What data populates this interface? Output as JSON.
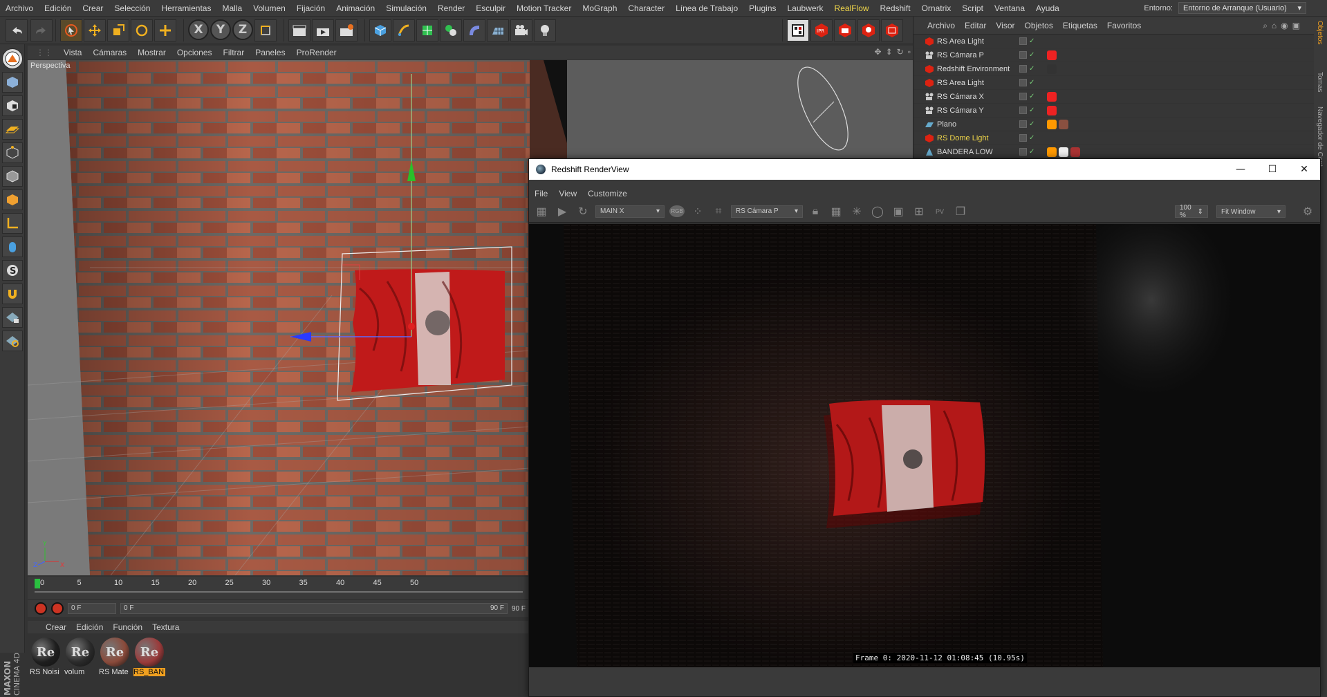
{
  "menubar": {
    "items": [
      "Archivo",
      "Edición",
      "Crear",
      "Selección",
      "Herramientas",
      "Malla",
      "Volumen",
      "Fijación",
      "Animación",
      "Simulación",
      "Render",
      "Esculpir",
      "Motion Tracker",
      "MoGraph",
      "Character",
      "Línea de Trabajo",
      "Plugins",
      "Laubwerk",
      "RealFlow",
      "Redshift",
      "Ornatrix",
      "Script",
      "Ventana",
      "Ayuda"
    ],
    "highlighted": "RealFlow",
    "env_label": "Entorno:",
    "env_value": "Entorno de Arranque (Usuario)"
  },
  "toolbar": {
    "axis_x": "X",
    "axis_y": "Y",
    "axis_z": "Z"
  },
  "viewport": {
    "menu": [
      "Vista",
      "Cámaras",
      "Mostrar",
      "Opciones",
      "Filtrar",
      "Paneles",
      "ProRender"
    ],
    "label": "Perspectiva",
    "axis_y": "Y",
    "axis_z": "Z",
    "axis_x": "X"
  },
  "timeline": {
    "ticks": [
      "0",
      "5",
      "10",
      "15",
      "20",
      "25",
      "30",
      "35",
      "40",
      "45",
      "50"
    ],
    "current_frame": "0 F",
    "start_field": "0 F",
    "end_field": "90 F",
    "end_frame": "90 F"
  },
  "materials": {
    "menu": [
      "Crear",
      "Edición",
      "Función",
      "Textura"
    ],
    "items": [
      {
        "name": "RS Noisi",
        "selected": false,
        "color": "#1e1e1e"
      },
      {
        "name": "volum",
        "selected": false,
        "color": "#2a2a2a"
      },
      {
        "name": "RS Mate",
        "selected": false,
        "color": "#8a4a3a"
      },
      {
        "name": "RS_BAN",
        "selected": true,
        "color": "#9a3a3a"
      }
    ],
    "badge": "Re"
  },
  "brand": {
    "line1": "MAXON",
    "line2": "CINEMA 4D"
  },
  "objects": {
    "menu": [
      "Archivo",
      "Editar",
      "Visor",
      "Objetos",
      "Etiquetas",
      "Favoritos"
    ],
    "rows": [
      {
        "name": "RS Area Light",
        "highlight": false
      },
      {
        "name": "RS Cámara P",
        "highlight": false
      },
      {
        "name": "Redshift Environment",
        "highlight": false
      },
      {
        "name": "RS Area Light",
        "highlight": false
      },
      {
        "name": "RS Cámara X",
        "highlight": false
      },
      {
        "name": "RS Cámara Y",
        "highlight": false
      },
      {
        "name": "Plano",
        "highlight": false
      },
      {
        "name": "RS Dome Light",
        "highlight": true
      },
      {
        "name": "BANDERA LOW",
        "highlight": false
      }
    ]
  },
  "sidetabs": [
    "Objetos",
    "Tomas",
    "Navegador de Cont"
  ],
  "renderview": {
    "title": "Redshift RenderView",
    "menu": [
      "File",
      "View",
      "Customize"
    ],
    "aov": "MAIN X",
    "rgb": "RGB",
    "camera": "RS Cámara P",
    "zoom": "100 %",
    "fit": "Fit Window",
    "caption": "Frame 0: 2020-11-12 01:08:45 (10.95s)"
  }
}
